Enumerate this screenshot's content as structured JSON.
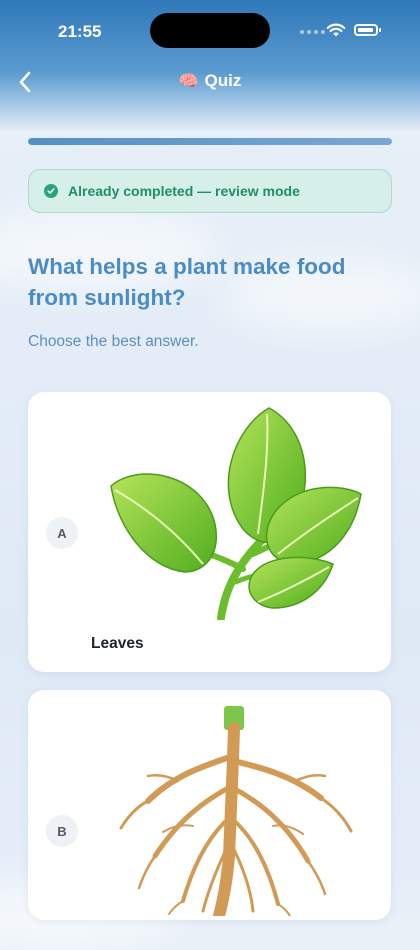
{
  "status_bar": {
    "time": "21:55"
  },
  "nav": {
    "title": "Quiz",
    "title_icon": "brain-icon",
    "back_icon": "chevron-left-icon"
  },
  "progress": {
    "fraction": 1.0
  },
  "banner": {
    "text": "Already completed — review mode",
    "icon": "check-circle-icon",
    "color": "#1f8f65"
  },
  "question": {
    "text": "What helps a plant make food from sunlight?",
    "instruction": "Choose the best answer."
  },
  "options": [
    {
      "letter": "A",
      "label": "Leaves",
      "image": "leaves-illustration"
    },
    {
      "letter": "B",
      "label": "",
      "image": "roots-illustration"
    }
  ],
  "colors": {
    "accent": "#4b8cc3",
    "success": "#2aa57a",
    "header": "#2f78b9"
  }
}
